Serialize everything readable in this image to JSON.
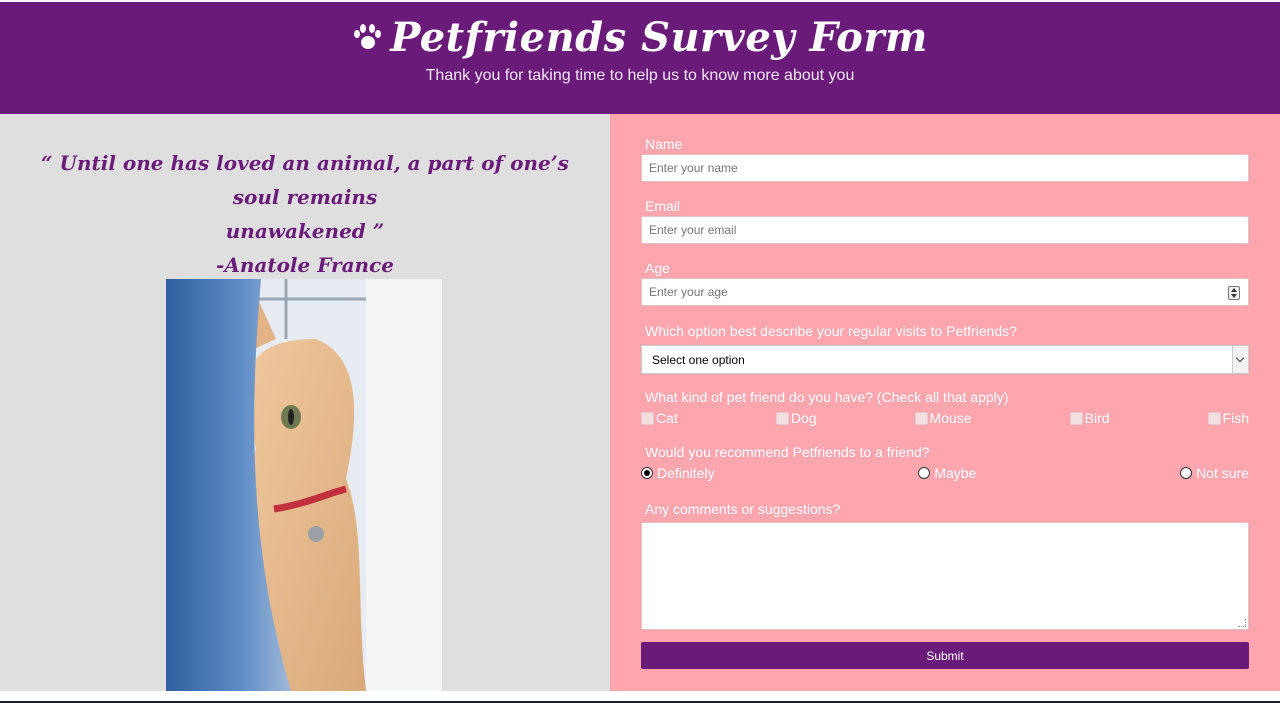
{
  "header": {
    "title": "Petfriends Survey Form",
    "subtitle": "Thank you for taking time to help us to know more about you",
    "icon": "paw-icon",
    "background": "#6a1b7a"
  },
  "quote": {
    "line1": "“ Until one has loved an animal, a part of one’s soul remains",
    "line2": "unawakened ”",
    "author": "-Anatole France"
  },
  "form": {
    "name_label": "Name",
    "name_placeholder": "Enter your name",
    "email_label": "Email",
    "email_placeholder": "Enter your email",
    "age_label": "Age",
    "age_placeholder": "Enter your age",
    "visits_label": "Which option best describe your regular visits to Petfriends?",
    "visits_selected": "Select one option",
    "pets_label": "What kind of pet friend do you have? (Check all that apply)",
    "pets": [
      "Cat",
      "Dog",
      "Mouse",
      "Bird",
      "Fish"
    ],
    "recommend_label": "Would you recommend Petfriends to a friend?",
    "recommend_options": [
      "Definitely",
      "Maybe",
      "Not sure"
    ],
    "recommend_selected": "Definitely",
    "comments_label": "Any comments or suggestions?",
    "submit_label": "Submit"
  },
  "colors": {
    "accent": "#6a1b7a",
    "form_bg": "#fea5ae",
    "side_bg": "#e0dfe0"
  }
}
